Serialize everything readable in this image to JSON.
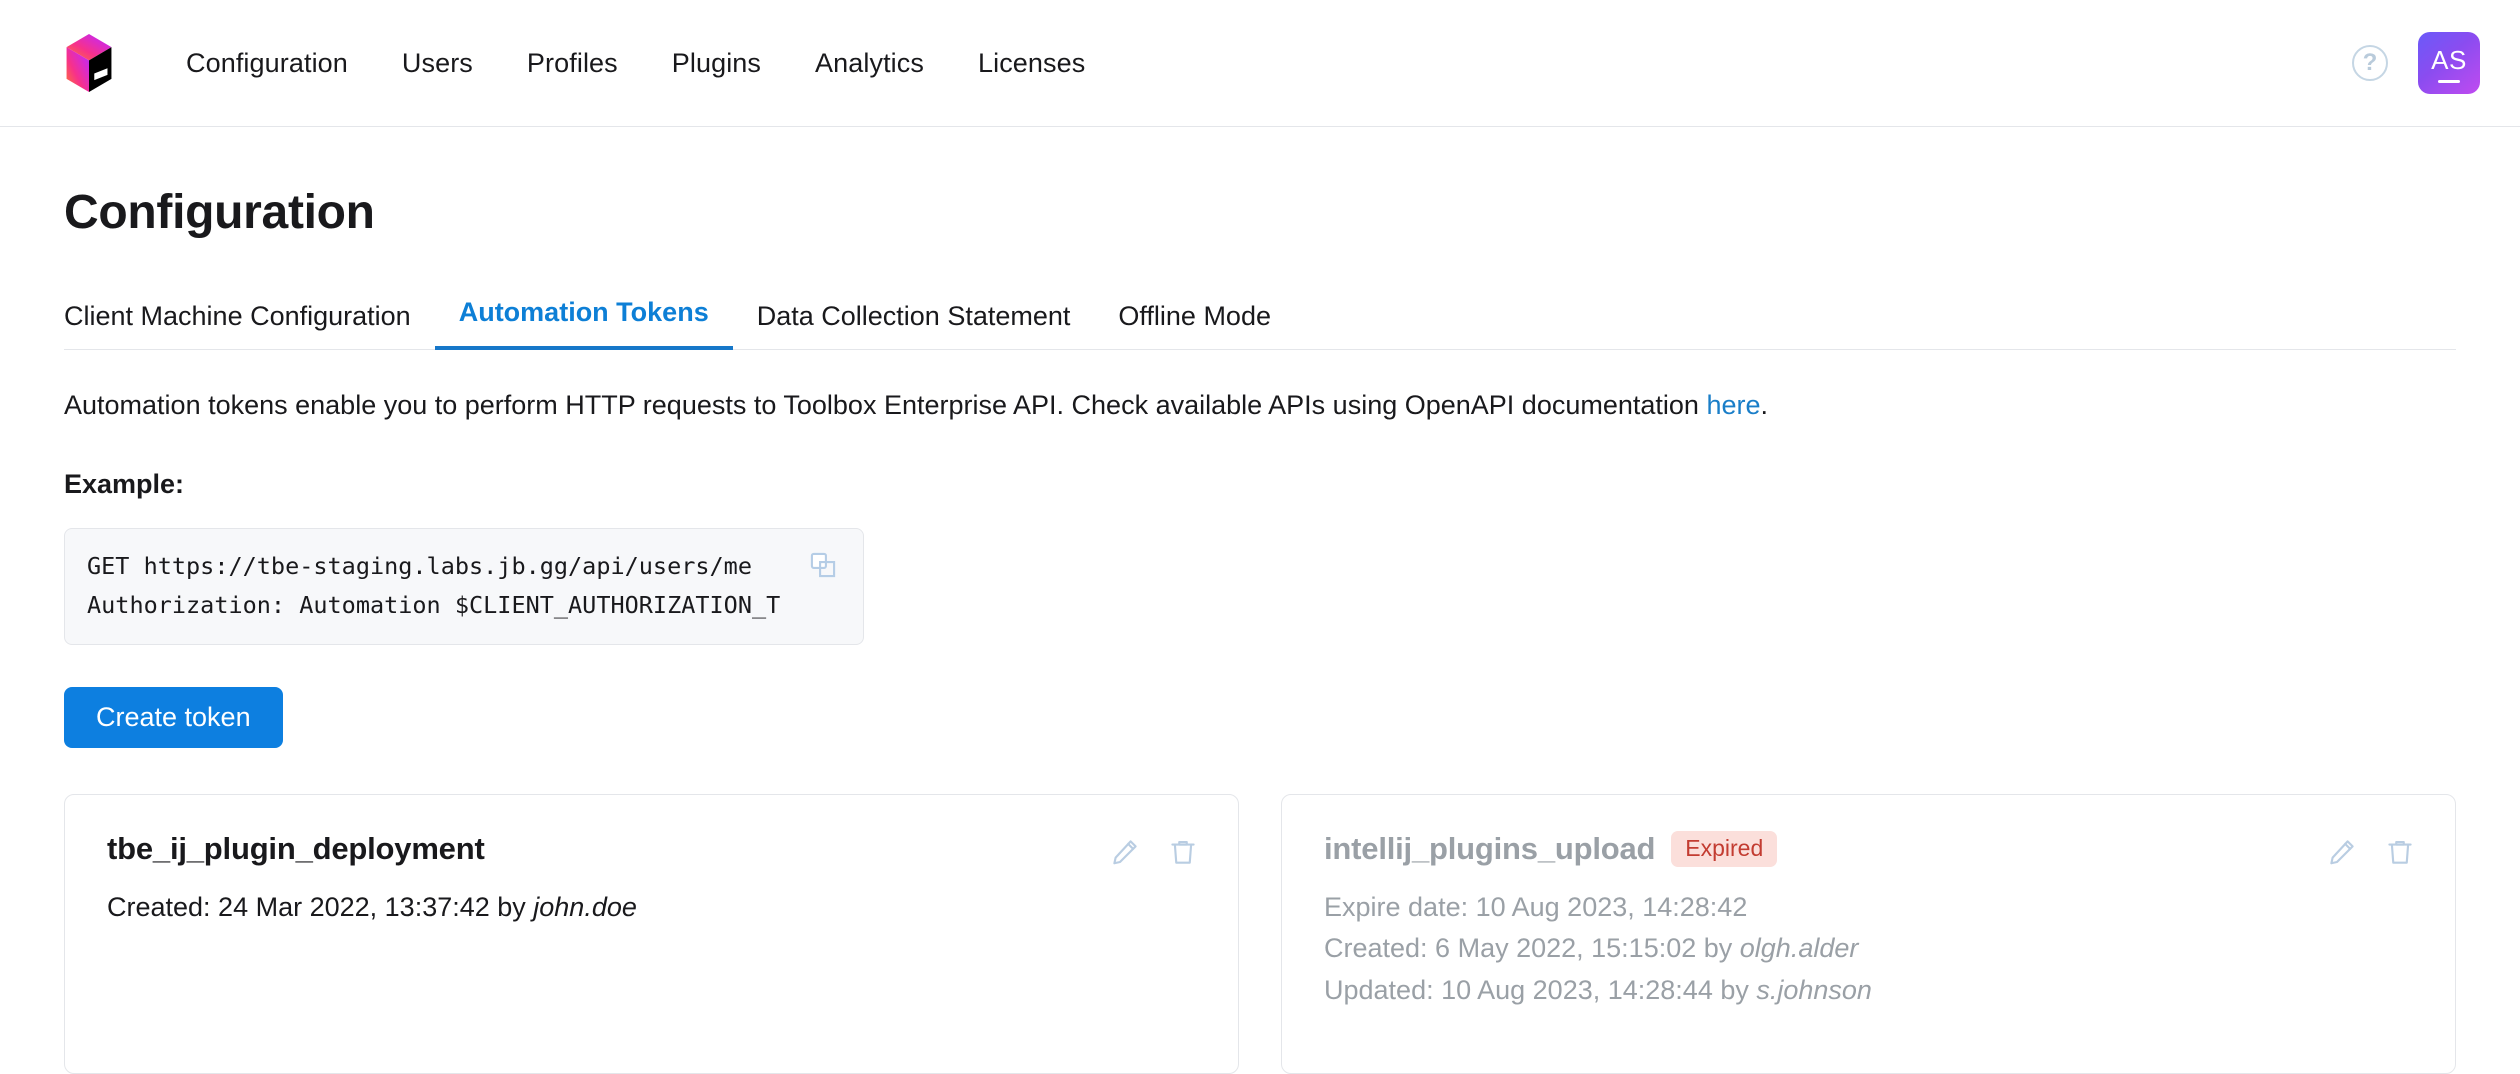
{
  "brand": {
    "logo_icon": "jetbrains-toolbox-cube-logo"
  },
  "topnav": {
    "items": [
      {
        "label": "Configuration",
        "active": true
      },
      {
        "label": "Users",
        "active": false
      },
      {
        "label": "Profiles",
        "active": false
      },
      {
        "label": "Plugins",
        "active": false
      },
      {
        "label": "Analytics",
        "active": false
      },
      {
        "label": "Licenses",
        "active": false
      }
    ],
    "help_icon": "help-circle-icon",
    "help_glyph": "?",
    "avatar": {
      "initials": "AS",
      "icon": "user-avatar"
    }
  },
  "page": {
    "title": "Configuration"
  },
  "tabs": [
    {
      "label": "Client Machine Configuration",
      "active": false
    },
    {
      "label": "Automation Tokens",
      "active": true
    },
    {
      "label": "Data Collection Statement",
      "active": false
    },
    {
      "label": "Offline Mode",
      "active": false
    }
  ],
  "description": {
    "before_link": "Automation tokens enable you to perform HTTP requests to Toolbox Enterprise API. Check available APIs using OpenAPI documentation ",
    "link_text": "here",
    "after_link": "."
  },
  "example": {
    "label": "Example:",
    "lines": [
      "GET https://tbe-staging.labs.jb.gg/api/users/me",
      "Authorization: Automation $CLIENT_AUTHORIZATION_T"
    ],
    "copy_icon": "copy-icon"
  },
  "create_button": {
    "label": "Create token"
  },
  "tokens": [
    {
      "name": "tbe_ij_plugin_deployment",
      "expired": false,
      "badge": null,
      "meta": [
        {
          "prefix": "Created: 24 Mar 2022, 13:37:42 by ",
          "user": "john.doe"
        }
      ],
      "edit_icon": "pencil-icon",
      "delete_icon": "trash-icon"
    },
    {
      "name": "intellij_plugins_upload",
      "expired": true,
      "badge": "Expired",
      "meta": [
        {
          "prefix": "Expire date: 10 Aug 2023, 14:28:42",
          "user": ""
        },
        {
          "prefix": "Created: 6 May 2022, 15:15:02 by ",
          "user": "olgh.alder"
        },
        {
          "prefix": "Updated: 10 Aug 2023, 14:28:44 by ",
          "user": "s.johnson"
        }
      ],
      "edit_icon": "pencil-icon",
      "delete_icon": "trash-icon"
    }
  ],
  "colors": {
    "accent_blue": "#0d7fe0",
    "tab_active": "#0d7fd6",
    "link": "#1a7ec8",
    "badge_bg": "#fbdfdb",
    "badge_text": "#c33c31",
    "muted_text": "#9aa0a6",
    "icon_blue": "#b9cde2",
    "border": "#e4e6ea",
    "code_bg": "#f7f8fa"
  }
}
